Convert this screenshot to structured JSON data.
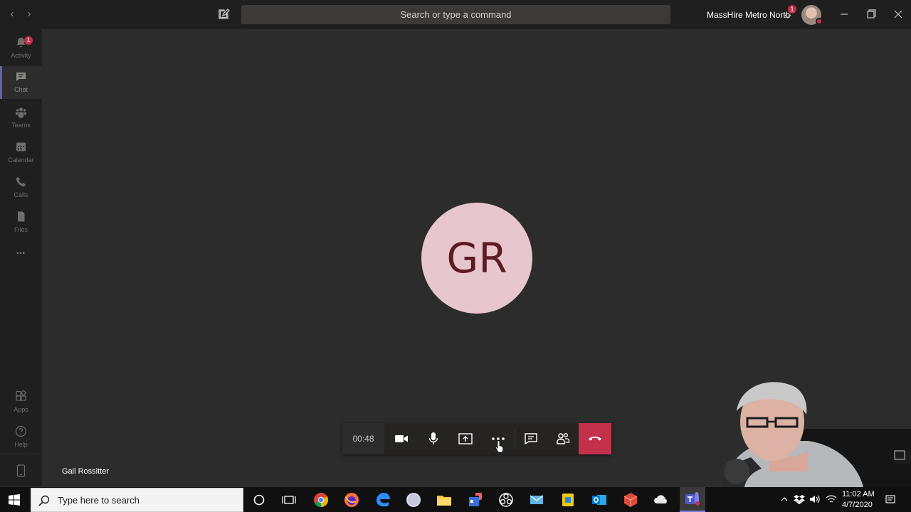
{
  "titlebar": {
    "back_glyph": "‹",
    "forward_glyph": "›",
    "search_placeholder": "Search or type a command",
    "org_name": "MassHire Metro North",
    "org_badge_count": "1",
    "icons": [
      "compose-icon",
      "chevron-down-icon",
      "minimize-icon",
      "restore-icon",
      "close-icon"
    ]
  },
  "rail": {
    "items": [
      {
        "label": "Activity",
        "icon": "bell-icon",
        "badge": "1"
      },
      {
        "label": "Chat",
        "icon": "chat-icon"
      },
      {
        "label": "Teams",
        "icon": "teams-icon"
      },
      {
        "label": "Calendar",
        "icon": "calendar-icon"
      },
      {
        "label": "Calls",
        "icon": "phone-icon"
      },
      {
        "label": "Files",
        "icon": "file-icon"
      }
    ],
    "more_glyph": "•••",
    "bottom": [
      {
        "label": "Apps",
        "icon": "apps-icon"
      },
      {
        "label": "Help",
        "icon": "help-icon"
      }
    ]
  },
  "call": {
    "avatar_initials": "GR",
    "participant_name": "Gail Rossitter",
    "timer": "00:48",
    "controls": [
      "video-camera-icon",
      "microphone-icon",
      "share-screen-icon",
      "more-options-icon",
      "conversation-icon",
      "participants-icon",
      "hang-up-icon"
    ]
  },
  "taskbar": {
    "search_placeholder": "Type here to search",
    "time": "11:02 AM",
    "date": "4/7/2020",
    "apps": [
      "cortana-icon",
      "task-view-icon",
      "chrome-icon",
      "firefox-icon",
      "edge-icon",
      "app-icon",
      "file-explorer-icon",
      "store-icon",
      "obs-icon",
      "mail-icon",
      "app-icon-2",
      "outlook-icon",
      "package-icon",
      "cloud-icon",
      "teams-icon"
    ]
  },
  "colors": {
    "background": "#2d2c2c",
    "rail": "#201f1f",
    "accent": "#6264a7",
    "hangup": "#c4314b",
    "avatar_bg": "#e8c6cd",
    "avatar_text": "#5e1a26"
  }
}
